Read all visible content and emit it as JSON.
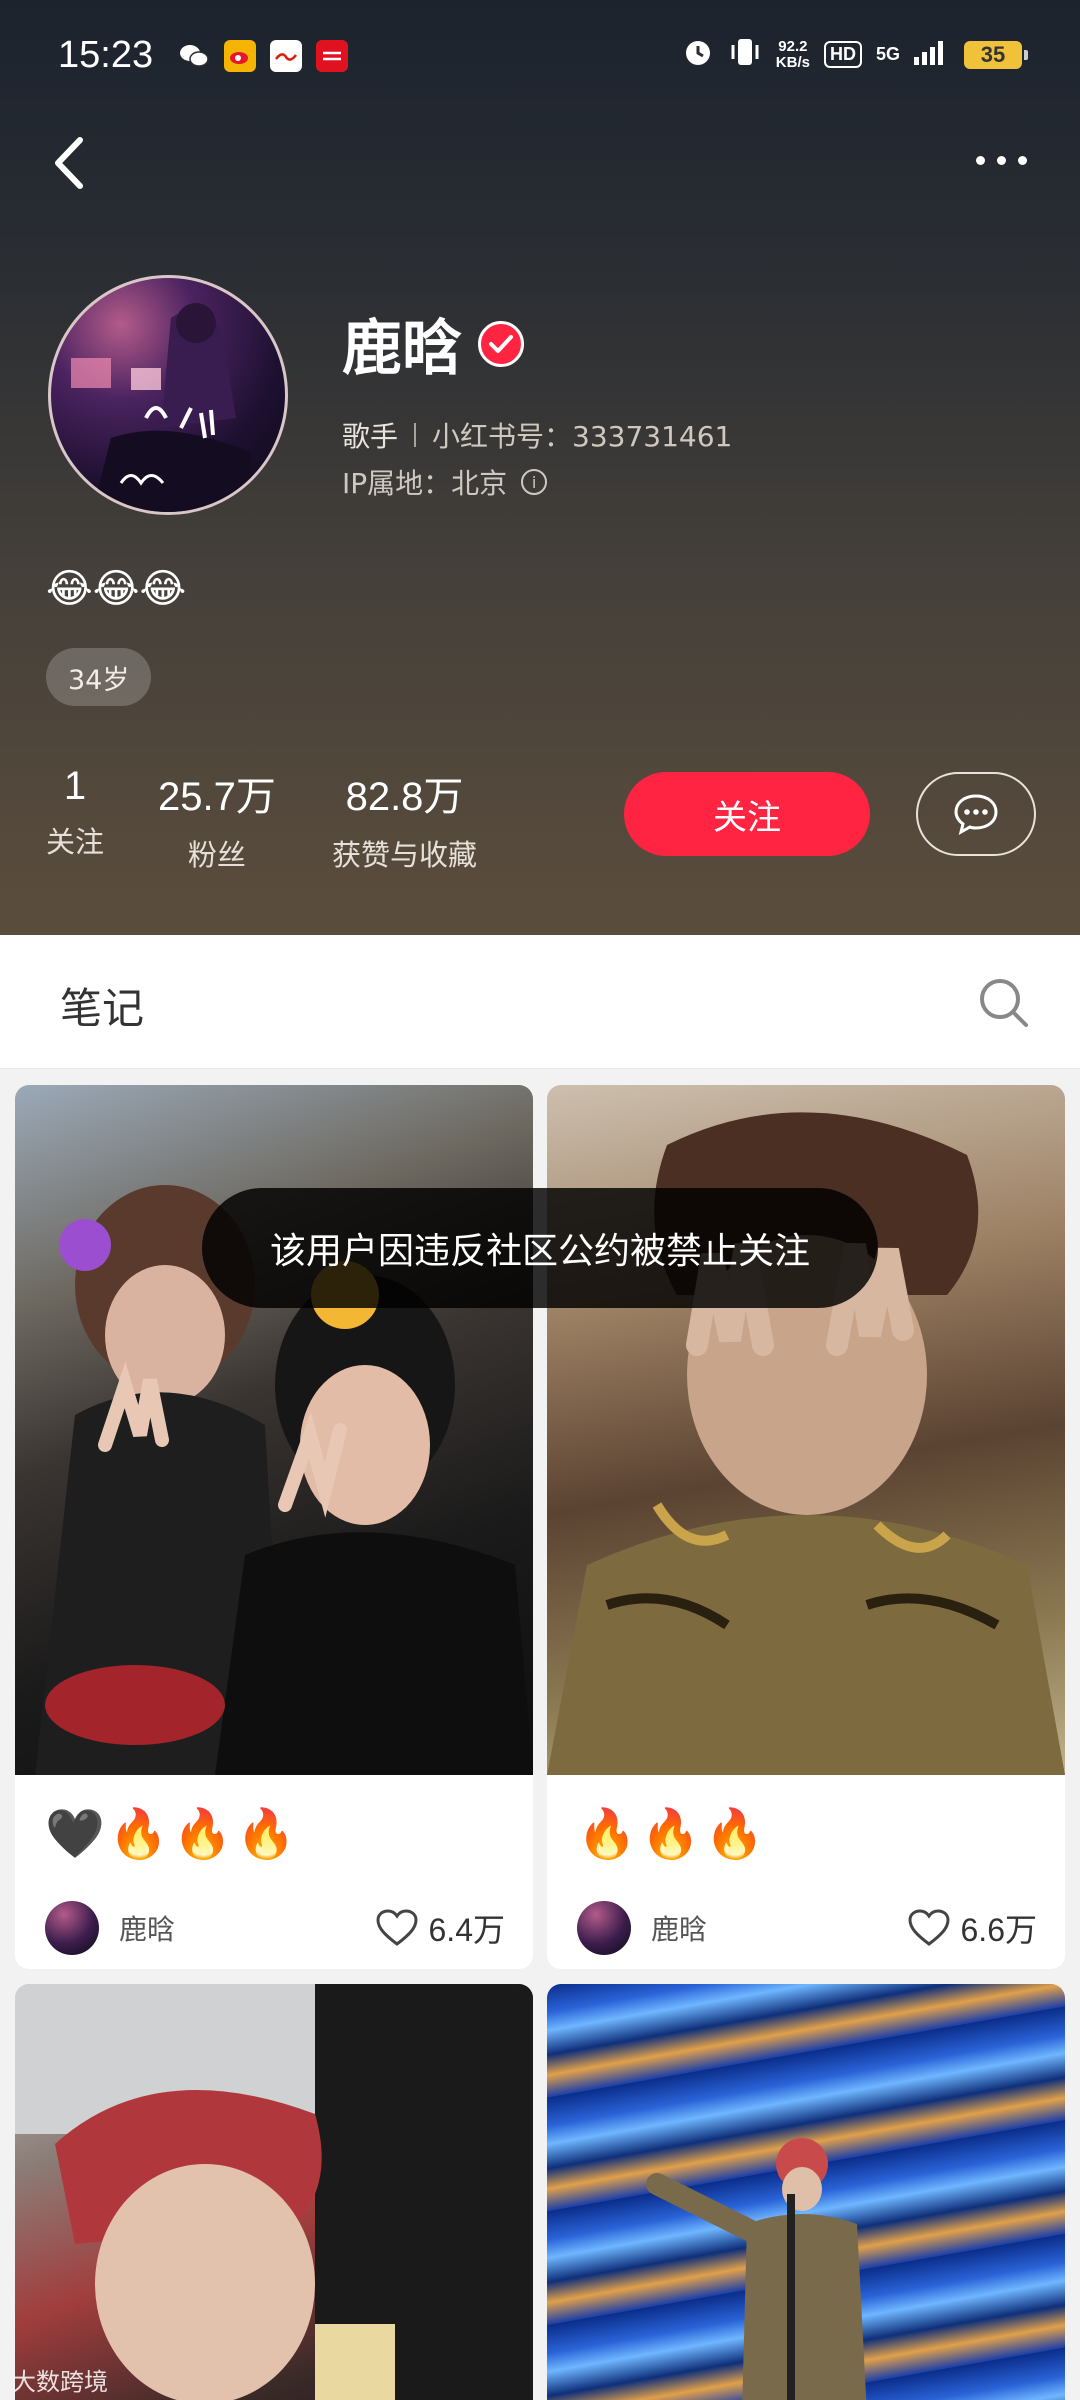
{
  "status_bar": {
    "time": "15:23",
    "net_speed_value": "92.2",
    "net_speed_unit": "KB/s",
    "hd": "HD",
    "network": "5G",
    "battery": "35"
  },
  "profile": {
    "nickname": "鹿晗",
    "occupation": "歌手",
    "redbook_id": "小红书号：333731461",
    "ip_location": "IP属地：北京",
    "bio": "😂😂😂",
    "age_tag": "34岁",
    "stats": [
      {
        "value": "1",
        "label": "关注"
      },
      {
        "value": "25.7万",
        "label": "粉丝"
      },
      {
        "value": "82.8万",
        "label": "获赞与收藏"
      }
    ],
    "follow_label": "关注"
  },
  "tabs": {
    "notes_label": "笔记"
  },
  "toast": "该用户因违反社区公约被禁止关注",
  "notes": [
    {
      "title": "🖤🔥🔥🔥",
      "author": "鹿晗",
      "likes": "6.4万"
    },
    {
      "title": "🔥🔥🔥",
      "author": "鹿晗",
      "likes": "6.6万"
    }
  ],
  "watermark": "大数跨境",
  "colors": {
    "accent_red": "#ff2442",
    "battery": "#f0c23c"
  }
}
